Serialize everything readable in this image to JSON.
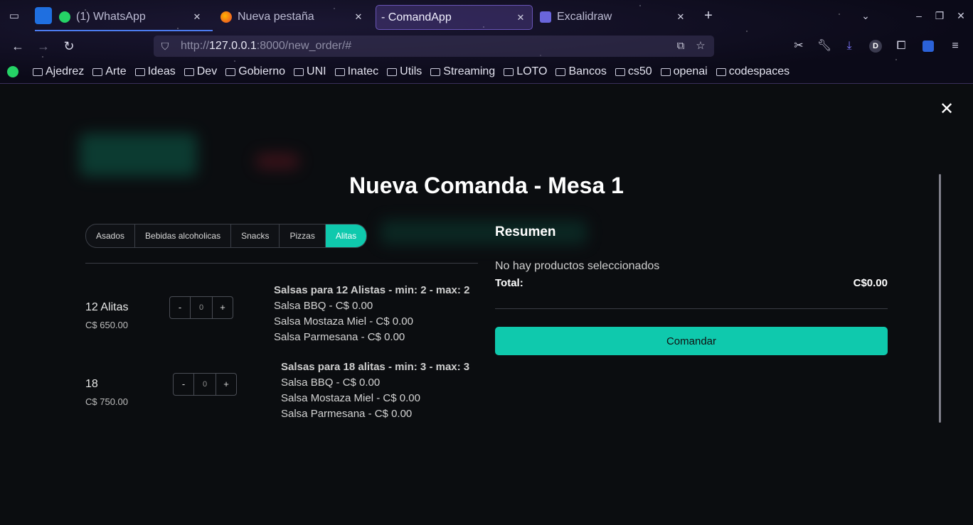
{
  "browser": {
    "tabs": [
      {
        "title": "(1) WhatsApp",
        "badge": "1"
      },
      {
        "title": "Nueva pestaña"
      },
      {
        "title": "- ComandApp"
      },
      {
        "title": "Excalidraw"
      }
    ],
    "url_dim_prefix": "http://",
    "url_host": "127.0.0.1",
    "url_rest": ":8000/new_order/#",
    "bookmarks": [
      "Ajedrez",
      "Arte",
      "Ideas",
      "Dev",
      "Gobierno",
      "UNI",
      "Inatec",
      "Utils",
      "Streaming",
      "LOTO",
      "Bancos",
      "cs50",
      "openai",
      "codespaces"
    ],
    "profile_initial": "D"
  },
  "modal": {
    "title": "Nueva Comanda - Mesa 1",
    "close_glyph": "✕",
    "categories": [
      "Asados",
      "Bebidas alcoholicas",
      "Snacks",
      "Pizzas",
      "Alitas"
    ],
    "active_category": "Alitas",
    "products": [
      {
        "name": "12 Alitas",
        "price": "C$ 650.00",
        "qty": "0",
        "sauce_header": "Salsas para 12 Alistas - min: 2 - max: 2",
        "sauces": [
          "Salsa BBQ - C$ 0.00",
          "Salsa Mostaza Miel - C$ 0.00",
          "Salsa Parmesana - C$ 0.00"
        ]
      },
      {
        "name": "18",
        "price": "C$ 750.00",
        "qty": "0",
        "sauce_header": "Salsas para 18 alitas - min: 3 - max: 3",
        "sauces": [
          "Salsa BBQ - C$ 0.00",
          "Salsa Mostaza Miel - C$ 0.00",
          "Salsa Parmesana - C$ 0.00"
        ]
      }
    ],
    "stepper_minus": "-",
    "stepper_plus": "+",
    "summary": {
      "title": "Resumen",
      "empty_text": "No hay productos seleccionados",
      "total_label": "Total:",
      "total_value": "C$0.00",
      "submit_label": "Comandar"
    }
  },
  "colors": {
    "accent": "#0fc9ad",
    "background": "#0d0f13"
  }
}
